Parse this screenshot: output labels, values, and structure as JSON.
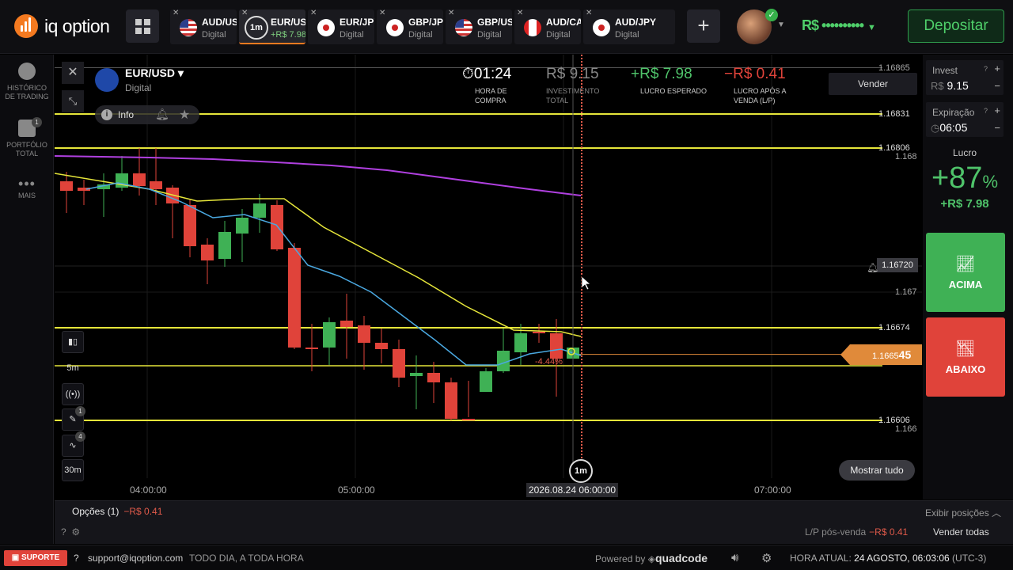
{
  "header": {
    "logo_text": "iq option",
    "tabs": [
      {
        "pair": "AUD/USD",
        "type": "Digital",
        "flag": "au"
      },
      {
        "pair": "EUR/USD",
        "type": "+R$ 7.98",
        "timeframe": "1m",
        "flag": "eu",
        "active": true
      },
      {
        "pair": "EUR/JPY",
        "type": "Digital",
        "flag": "eu"
      },
      {
        "pair": "GBP/JPY",
        "type": "Digital",
        "flag": "gb"
      },
      {
        "pair": "GBP/USD",
        "type": "Digital",
        "flag": "gb"
      },
      {
        "pair": "AUD/CAD",
        "type": "Digital",
        "flag": "au"
      },
      {
        "pair": "AUD/JPY",
        "type": "Digital",
        "flag": "au"
      }
    ],
    "add_tab": "+",
    "balance": "R$ ••••••••••",
    "deposit_label": "Depositar"
  },
  "sidebar": {
    "items": [
      {
        "label_1": "HISTÓRICO",
        "label_2": "DE TRADING"
      },
      {
        "label_1": "PORTFÓLIO",
        "label_2": "TOTAL",
        "badge": "1"
      },
      {
        "label_1": "MAIS"
      }
    ]
  },
  "asset": {
    "name": "EUR/USD",
    "type": "Digital",
    "info_label": "Info"
  },
  "stats": {
    "timer": "01:24",
    "timer_label_1": "HORA DE",
    "timer_label_2": "COMPRA",
    "investment": "R$ 9.15",
    "investment_label_1": "INVESTIMENTO",
    "investment_label_2": "TOTAL",
    "expected": "+R$ 7.98",
    "expected_label": "LUCRO ESPERADO",
    "after_sale": "−R$ 0.41",
    "after_sale_label_1": "LUCRO APÓS A",
    "after_sale_label_2": "VENDA (L/P)",
    "sell_label": "Vender"
  },
  "chart": {
    "price_labels": [
      "1.16865",
      "1.16831",
      "1.16806",
      "1.168",
      "1.16720",
      "1.167",
      "1.16674",
      "1.16606",
      "1.166"
    ],
    "current_price_main": "1.1665",
    "current_price_end": "45",
    "pct_label": "-4.44%",
    "time_labels": [
      "04:00:00",
      "05:00:00",
      "07:00:00"
    ],
    "date_label": "2026.08.24 06:00:00",
    "timeframe": "1m",
    "show_all": "Mostrar tudo",
    "tools": [
      {
        "label": "5m"
      },
      {
        "label": "30m"
      }
    ],
    "tool_badges": [
      "1",
      "4"
    ]
  },
  "chart_data": {
    "type": "candlestick",
    "instrument": "EUR/USD",
    "x": [
      "03:55",
      "04:00",
      "04:05",
      "04:10",
      "04:15",
      "04:20",
      "04:25",
      "04:30",
      "04:35",
      "04:40",
      "04:45",
      "04:50",
      "04:55",
      "05:00",
      "05:05",
      "05:10",
      "05:15",
      "05:20",
      "05:25",
      "05:30",
      "05:35",
      "05:40",
      "05:45",
      "05:50",
      "05:55",
      "06:00"
    ],
    "ylim": [
      1.1658,
      1.1688
    ],
    "horizontal_levels": [
      1.16865,
      1.16831,
      1.16806,
      1.16674,
      1.16606
    ],
    "alert_level": 1.1672,
    "current_price": 1.166545
  },
  "right_panel": {
    "invest_label": "Invest",
    "invest_currency": "R$",
    "invest_value": "9.15",
    "expiry_label": "Expiração",
    "expiry_value": "06:05",
    "profit_label": "Lucro",
    "profit_pct": "+87",
    "profit_pct_sign": "%",
    "profit_amount": "+R$ 7.98",
    "up_label": "ACIMA",
    "down_label": "ABAIXO"
  },
  "bottom": {
    "options_label": "Opções (1)",
    "options_value": "−R$ 0.41",
    "show_positions": "Exibir posições",
    "lp_label": "L/P pós-venda",
    "lp_value": "−R$ 0.41",
    "sell_all": "Vender todas"
  },
  "footer": {
    "support": "SUPORTE",
    "email": "support@iqoption.com",
    "hours": "TODO DIA, A TODA HORA",
    "powered_by": "Powered by",
    "brand": "quadcode",
    "time_label": "HORA ATUAL:",
    "time_value": "24 AGOSTO, 06:03:06",
    "tz": "(UTC-3)"
  }
}
